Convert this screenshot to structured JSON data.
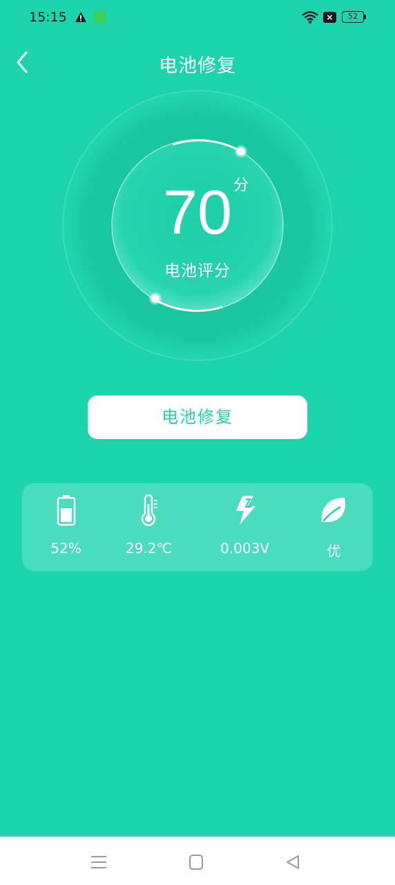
{
  "status_bar": {
    "time": "15:15",
    "battery_level": "52",
    "icons": [
      "warning-icon",
      "app-notification-icon",
      "wifi-icon",
      "sim-off-icon",
      "battery-icon"
    ]
  },
  "header": {
    "title": "电池修复",
    "back_icon": "chevron-left-icon"
  },
  "score": {
    "value": "70",
    "unit": "分",
    "label": "电池评分"
  },
  "repair_button": {
    "label": "电池修复"
  },
  "stats": [
    {
      "icon": "battery-level-icon",
      "value": "52%"
    },
    {
      "icon": "thermometer-icon",
      "value": "29.2℃"
    },
    {
      "icon": "lightning-icon",
      "value": "0.003V"
    },
    {
      "icon": "leaf-icon",
      "value": "优"
    }
  ],
  "nav_bar": {
    "buttons": [
      "menu-icon",
      "home-square-icon",
      "back-triangle-icon"
    ]
  },
  "colors": {
    "background": "#1dd5ad",
    "accent": "#1dd5ad",
    "button_bg": "#ffffff",
    "text": "#ffffff"
  }
}
